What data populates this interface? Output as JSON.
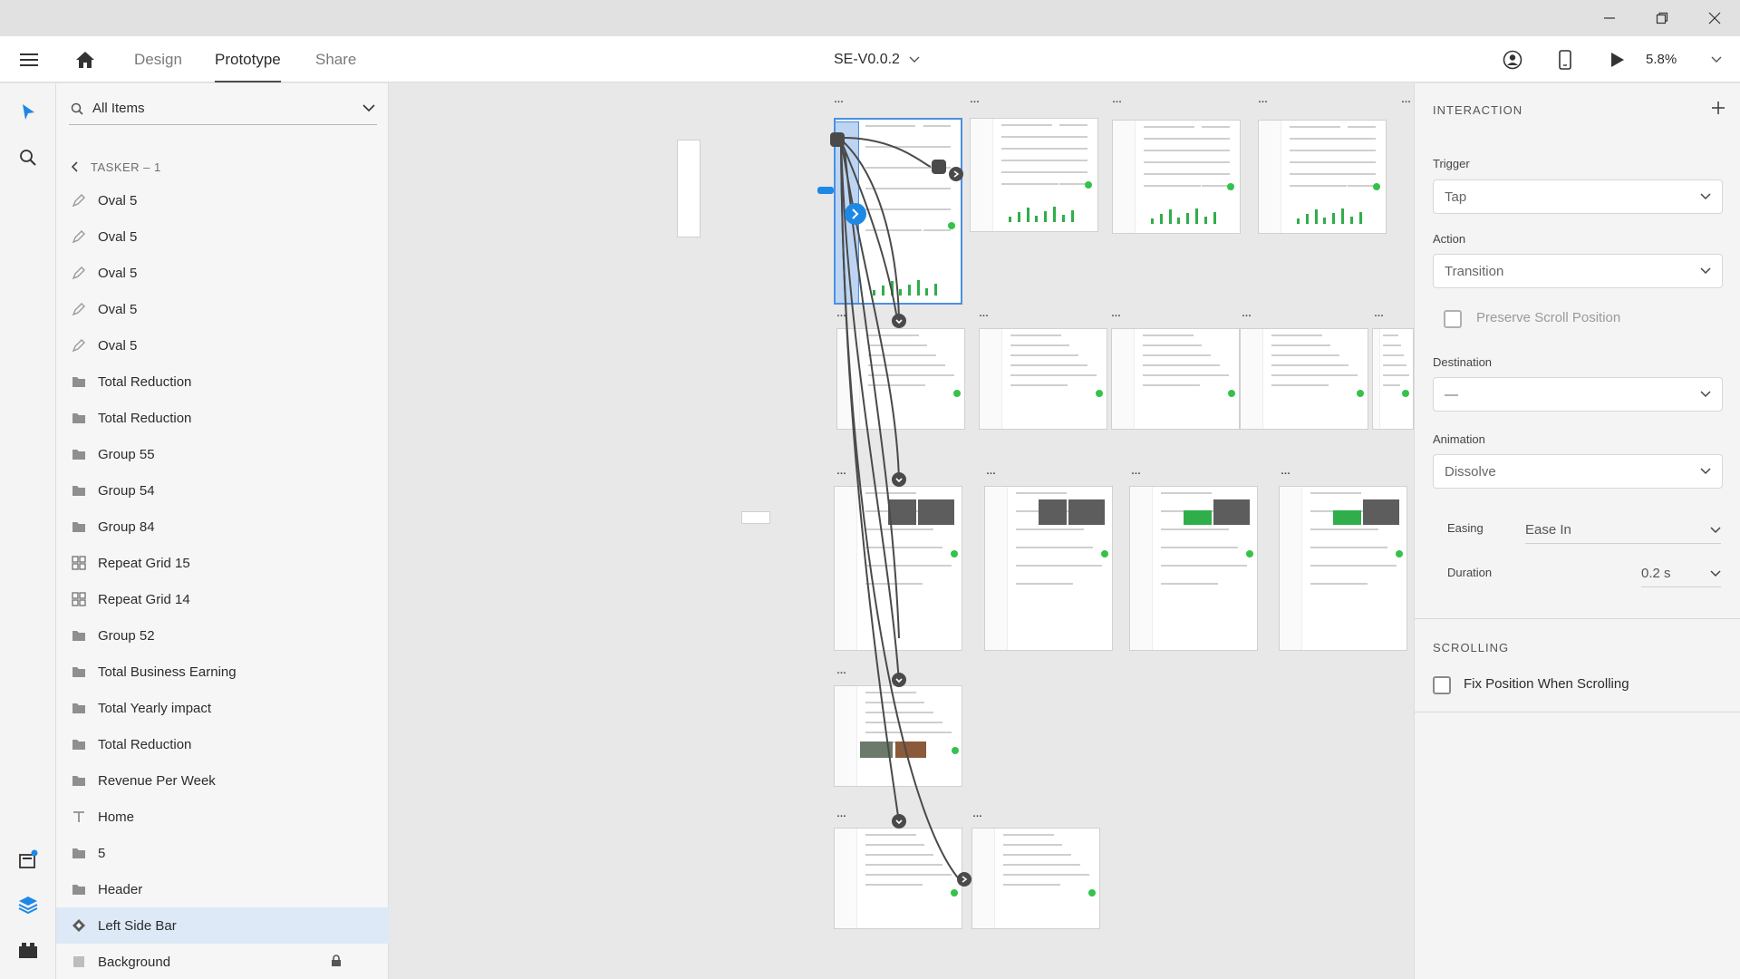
{
  "header": {
    "tabs": [
      {
        "label": "Design"
      },
      {
        "label": "Prototype"
      },
      {
        "label": "Share"
      }
    ],
    "document_title": "SE-V0.0.2",
    "zoom": "5.8%"
  },
  "layers": {
    "search_label": "All Items",
    "breadcrumb": "TASKER – 1",
    "items": [
      {
        "label": "Oval 5",
        "icon": "pen-icon"
      },
      {
        "label": "Oval 5",
        "icon": "pen-icon"
      },
      {
        "label": "Oval 5",
        "icon": "pen-icon"
      },
      {
        "label": "Oval 5",
        "icon": "pen-icon"
      },
      {
        "label": "Oval 5",
        "icon": "pen-icon"
      },
      {
        "label": "Total Reduction",
        "icon": "folder-icon"
      },
      {
        "label": "Total Reduction",
        "icon": "folder-icon"
      },
      {
        "label": "Group 55",
        "icon": "folder-icon"
      },
      {
        "label": "Group 54",
        "icon": "folder-icon"
      },
      {
        "label": "Group 84",
        "icon": "folder-icon"
      },
      {
        "label": "Repeat Grid 15",
        "icon": "grid-icon"
      },
      {
        "label": "Repeat Grid 14",
        "icon": "grid-icon"
      },
      {
        "label": "Group 52",
        "icon": "folder-icon"
      },
      {
        "label": "Total Business Earning",
        "icon": "folder-icon"
      },
      {
        "label": "Total Yearly impact",
        "icon": "folder-icon"
      },
      {
        "label": "Total Reduction",
        "icon": "folder-icon"
      },
      {
        "label": "Revenue Per Week",
        "icon": "folder-icon"
      },
      {
        "label": "Home",
        "icon": "text-icon"
      },
      {
        "label": "5",
        "icon": "folder-icon"
      },
      {
        "label": "Header",
        "icon": "folder-icon"
      },
      {
        "label": "Left Side Bar",
        "icon": "component-icon",
        "selected": true
      },
      {
        "label": "Background",
        "icon": "rectangle-icon",
        "locked": true
      }
    ]
  },
  "properties": {
    "interaction_title": "INTERACTION",
    "trigger_label": "Trigger",
    "trigger_value": "Tap",
    "action_label": "Action",
    "action_value": "Transition",
    "preserve_scroll_label": "Preserve Scroll Position",
    "destination_label": "Destination",
    "destination_value": "—",
    "animation_label": "Animation",
    "animation_value": "Dissolve",
    "easing_label": "Easing",
    "easing_value": "Ease In",
    "duration_label": "Duration",
    "duration_value": "0.2 s",
    "scrolling_title": "SCROLLING",
    "fix_position_label": "Fix Position When Scrolling"
  },
  "colors": {
    "accent": "#1e88e5",
    "selection": "#dde9f7",
    "green": "#2fae4a"
  }
}
